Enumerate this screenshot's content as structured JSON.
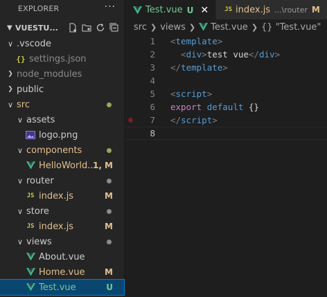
{
  "sidebar": {
    "title": "EXPLORER",
    "more": "···",
    "folder_name": "VUESTU...",
    "tree": [
      {
        "label": ".vscode",
        "type": "folder-open",
        "depth": 1,
        "color": "#cccccc"
      },
      {
        "label": "settings.json",
        "type": "json",
        "depth": 2,
        "color": "#8b8b8b"
      },
      {
        "label": "node_modules",
        "type": "folder-closed",
        "depth": 1,
        "color": "#8b8b8b"
      },
      {
        "label": "public",
        "type": "folder-closed",
        "depth": 1,
        "color": "#cccccc"
      },
      {
        "label": "src",
        "type": "folder-open",
        "depth": 1,
        "color": "#e2c08d",
        "dot": "#a0a060"
      },
      {
        "label": "assets",
        "type": "folder-open",
        "depth": 2,
        "color": "#cccccc"
      },
      {
        "label": "logo.png",
        "type": "image",
        "depth": 3,
        "color": "#cccccc"
      },
      {
        "label": "components",
        "type": "folder-open",
        "depth": 2,
        "color": "#e2c08d",
        "dot": "#a0a060"
      },
      {
        "label": "HelloWorld....",
        "type": "vue",
        "depth": 3,
        "color": "#e2c08d",
        "badge": "1, M"
      },
      {
        "label": "router",
        "type": "folder-open",
        "depth": 2,
        "color": "#cccccc",
        "dot": "#8b8b8b"
      },
      {
        "label": "index.js",
        "type": "js",
        "depth": 3,
        "color": "#e2c08d",
        "badge": "M"
      },
      {
        "label": "store",
        "type": "folder-open",
        "depth": 2,
        "color": "#cccccc",
        "dot": "#8b8b8b"
      },
      {
        "label": "index.js",
        "type": "js",
        "depth": 3,
        "color": "#e2c08d",
        "badge": "M"
      },
      {
        "label": "views",
        "type": "folder-open",
        "depth": 2,
        "color": "#cccccc",
        "dot": "#8b8b8b"
      },
      {
        "label": "About.vue",
        "type": "vue",
        "depth": 3,
        "color": "#cccccc"
      },
      {
        "label": "Home.vue",
        "type": "vue",
        "depth": 3,
        "color": "#e2c08d",
        "badge": "M"
      },
      {
        "label": "Test.vue",
        "type": "vue",
        "depth": 3,
        "color": "#73c991",
        "badge": "U",
        "selected": true
      }
    ]
  },
  "tabs": [
    {
      "label": "Test.vue",
      "mark": "U",
      "active": true,
      "icon": "vue-icon"
    },
    {
      "label": "index.js",
      "sub": "...\\router",
      "mark": "M",
      "active": false,
      "icon": "js-icon"
    }
  ],
  "breadcrumb": {
    "parts": [
      "src",
      "views"
    ],
    "file": "Test.vue",
    "symbol": "{} \"Test.vue\""
  },
  "editor": {
    "current_line": 8,
    "breakpoint_line": 7,
    "lines": [
      [
        {
          "t": "<",
          "c": "bracket"
        },
        {
          "t": "template",
          "c": "tag"
        },
        {
          "t": ">",
          "c": "bracket"
        }
      ],
      [
        {
          "t": "  ",
          "c": "text"
        },
        {
          "t": "<",
          "c": "bracket"
        },
        {
          "t": "div",
          "c": "tag"
        },
        {
          "t": ">",
          "c": "bracket"
        },
        {
          "t": "test vue",
          "c": "text"
        },
        {
          "t": "</",
          "c": "bracket"
        },
        {
          "t": "div",
          "c": "tag"
        },
        {
          "t": ">",
          "c": "bracket"
        }
      ],
      [
        {
          "t": "</",
          "c": "bracket"
        },
        {
          "t": "template",
          "c": "tag"
        },
        {
          "t": ">",
          "c": "bracket"
        }
      ],
      [],
      [
        {
          "t": "<",
          "c": "bracket"
        },
        {
          "t": "script",
          "c": "tag"
        },
        {
          "t": ">",
          "c": "bracket"
        }
      ],
      [
        {
          "t": "export",
          "c": "kw"
        },
        {
          "t": " ",
          "c": "text"
        },
        {
          "t": "default",
          "c": "kw"
        },
        {
          "t": " {}",
          "c": "text"
        }
      ],
      [
        {
          "t": "</",
          "c": "bracket"
        },
        {
          "t": "script",
          "c": "tag"
        },
        {
          "t": ">",
          "c": "bracket"
        }
      ],
      []
    ]
  },
  "colors": {
    "untracked": "#73c991",
    "modified": "#e2c08d",
    "vue_green": "#41b883",
    "js_yellow": "#cbcb41"
  }
}
